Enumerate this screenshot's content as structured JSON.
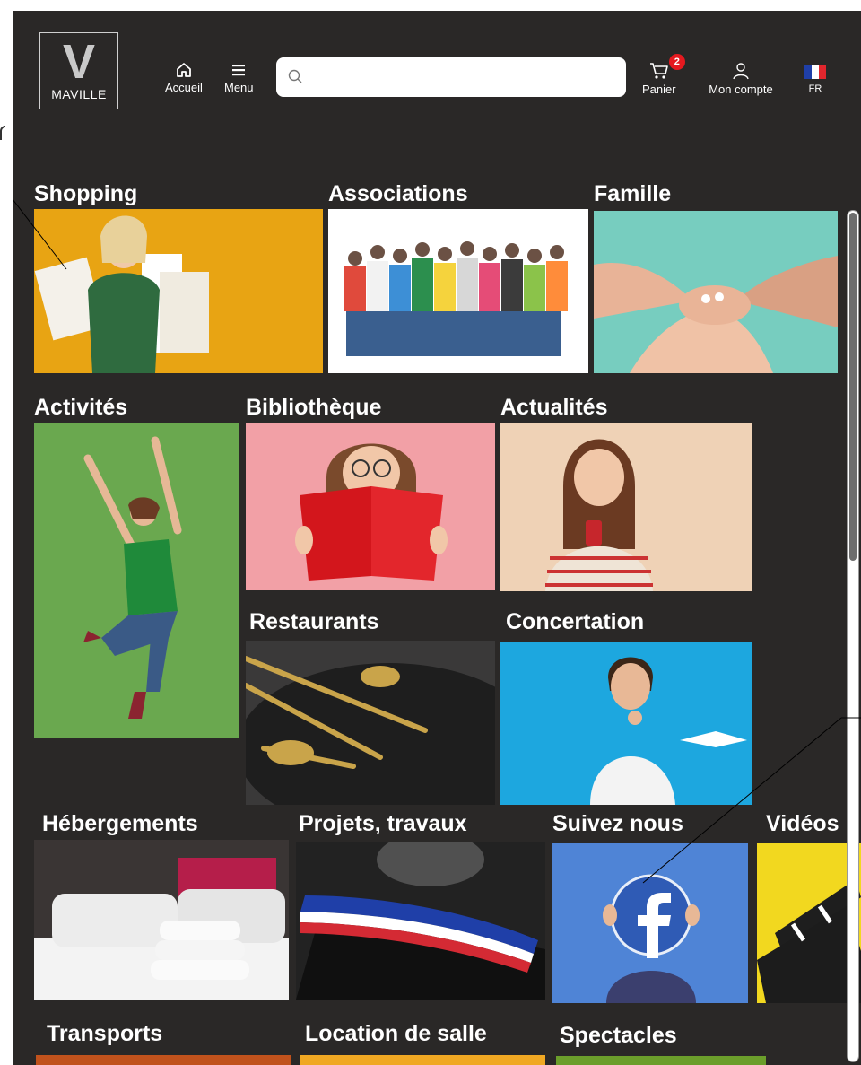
{
  "header": {
    "logo_letter": "V",
    "logo_name": "MAVILLE",
    "home_label": "Accueil",
    "menu_label": "Menu",
    "search_placeholder": "",
    "cart_label": "Panier",
    "cart_count": "2",
    "account_label": "Mon compte",
    "lang_label": "FR"
  },
  "tiles": [
    {
      "title": "Shopping"
    },
    {
      "title": "Associations"
    },
    {
      "title": "Famille"
    },
    {
      "title": "Activités"
    },
    {
      "title": "Bibliothèque"
    },
    {
      "title": "Actualités"
    },
    {
      "title": "Restaurants"
    },
    {
      "title": "Concertation"
    },
    {
      "title": "Hébergements"
    },
    {
      "title": "Projets, travaux"
    },
    {
      "title": "Suivez nous"
    },
    {
      "title": "Vidéos"
    },
    {
      "title": "Transports"
    },
    {
      "title": "Location de salle"
    },
    {
      "title": "Spectacles"
    }
  ],
  "colors": {
    "background": "#2a2827",
    "cart_badge": "#e5191f"
  }
}
